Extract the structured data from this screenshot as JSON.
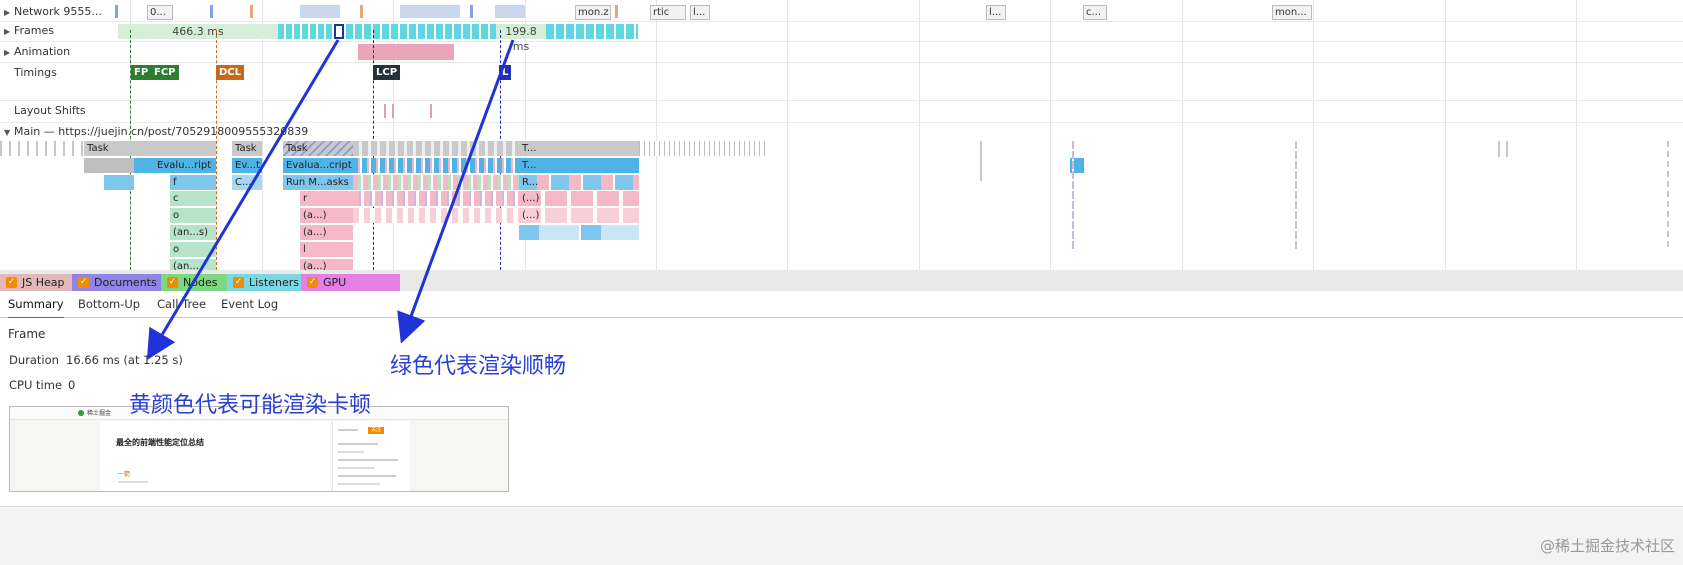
{
  "tracks": {
    "network": "Network 9555...",
    "frames": "Frames",
    "animation": "Animation",
    "timings": "Timings",
    "layout_shifts": "Layout Shifts",
    "main": "Main — https://juejin.cn/post/7052918009555320839"
  },
  "network_items": [
    "0...",
    "mon.z",
    "rtic",
    "l...",
    "l...",
    "c...",
    "mon..."
  ],
  "frames": {
    "duration_a": "466.3 ms",
    "duration_b": "199.8 ms"
  },
  "timings": {
    "fp": "FP",
    "fcp": "FCP",
    "dcl": "DCL",
    "lcp": "LCP",
    "l": "L"
  },
  "timing_colors": {
    "fp": "#2e7d32",
    "fcp": "#2e7d32",
    "dcl": "#c8681a",
    "lcp": "#263238",
    "l": "#2330b5"
  },
  "flame": {
    "task": "Task",
    "task_short": "T...",
    "eval_1": "Evalu...ript",
    "eval_2": "Ev...t",
    "eval_3": "Evalua...cript",
    "c_short": "C...",
    "run_micro": "Run M...asks",
    "r_short": "R...",
    "f": "f",
    "c": "c",
    "r": "r",
    "o": "o",
    "anon_s": "(an...s)",
    "anon_a": "(a...)",
    "anon_dots": "(...)",
    "l": "l",
    "anon_cut": "(an..."
  },
  "legend": [
    {
      "label": "JS Heap",
      "color": "#e2b8b8"
    },
    {
      "label": "Documents",
      "color": "#8e85e6"
    },
    {
      "label": "Nodes",
      "color": "#7dd77f"
    },
    {
      "label": "Listeners",
      "color": "#7ad8e3"
    },
    {
      "label": "GPU Memory",
      "color": "#e57fe6"
    }
  ],
  "tabs": [
    "Summary",
    "Bottom-Up",
    "Call Tree",
    "Event Log"
  ],
  "active_tab": "Summary",
  "summary": {
    "title": "Frame",
    "duration_label": "Duration",
    "duration_value": "16.66 ms (at 1.25 s)",
    "cpu_label": "CPU time",
    "cpu_value": "0"
  },
  "thumbnail": {
    "logo": "稀土掘金",
    "heading": "最全的前端性能定位总结",
    "tag": "一箭",
    "badge": "关注"
  },
  "annotations": {
    "green": "绿色代表渲染顺畅",
    "yellow": "黄颜色代表可能渲染卡顿"
  },
  "watermark": "@稀土掘金技术社区"
}
